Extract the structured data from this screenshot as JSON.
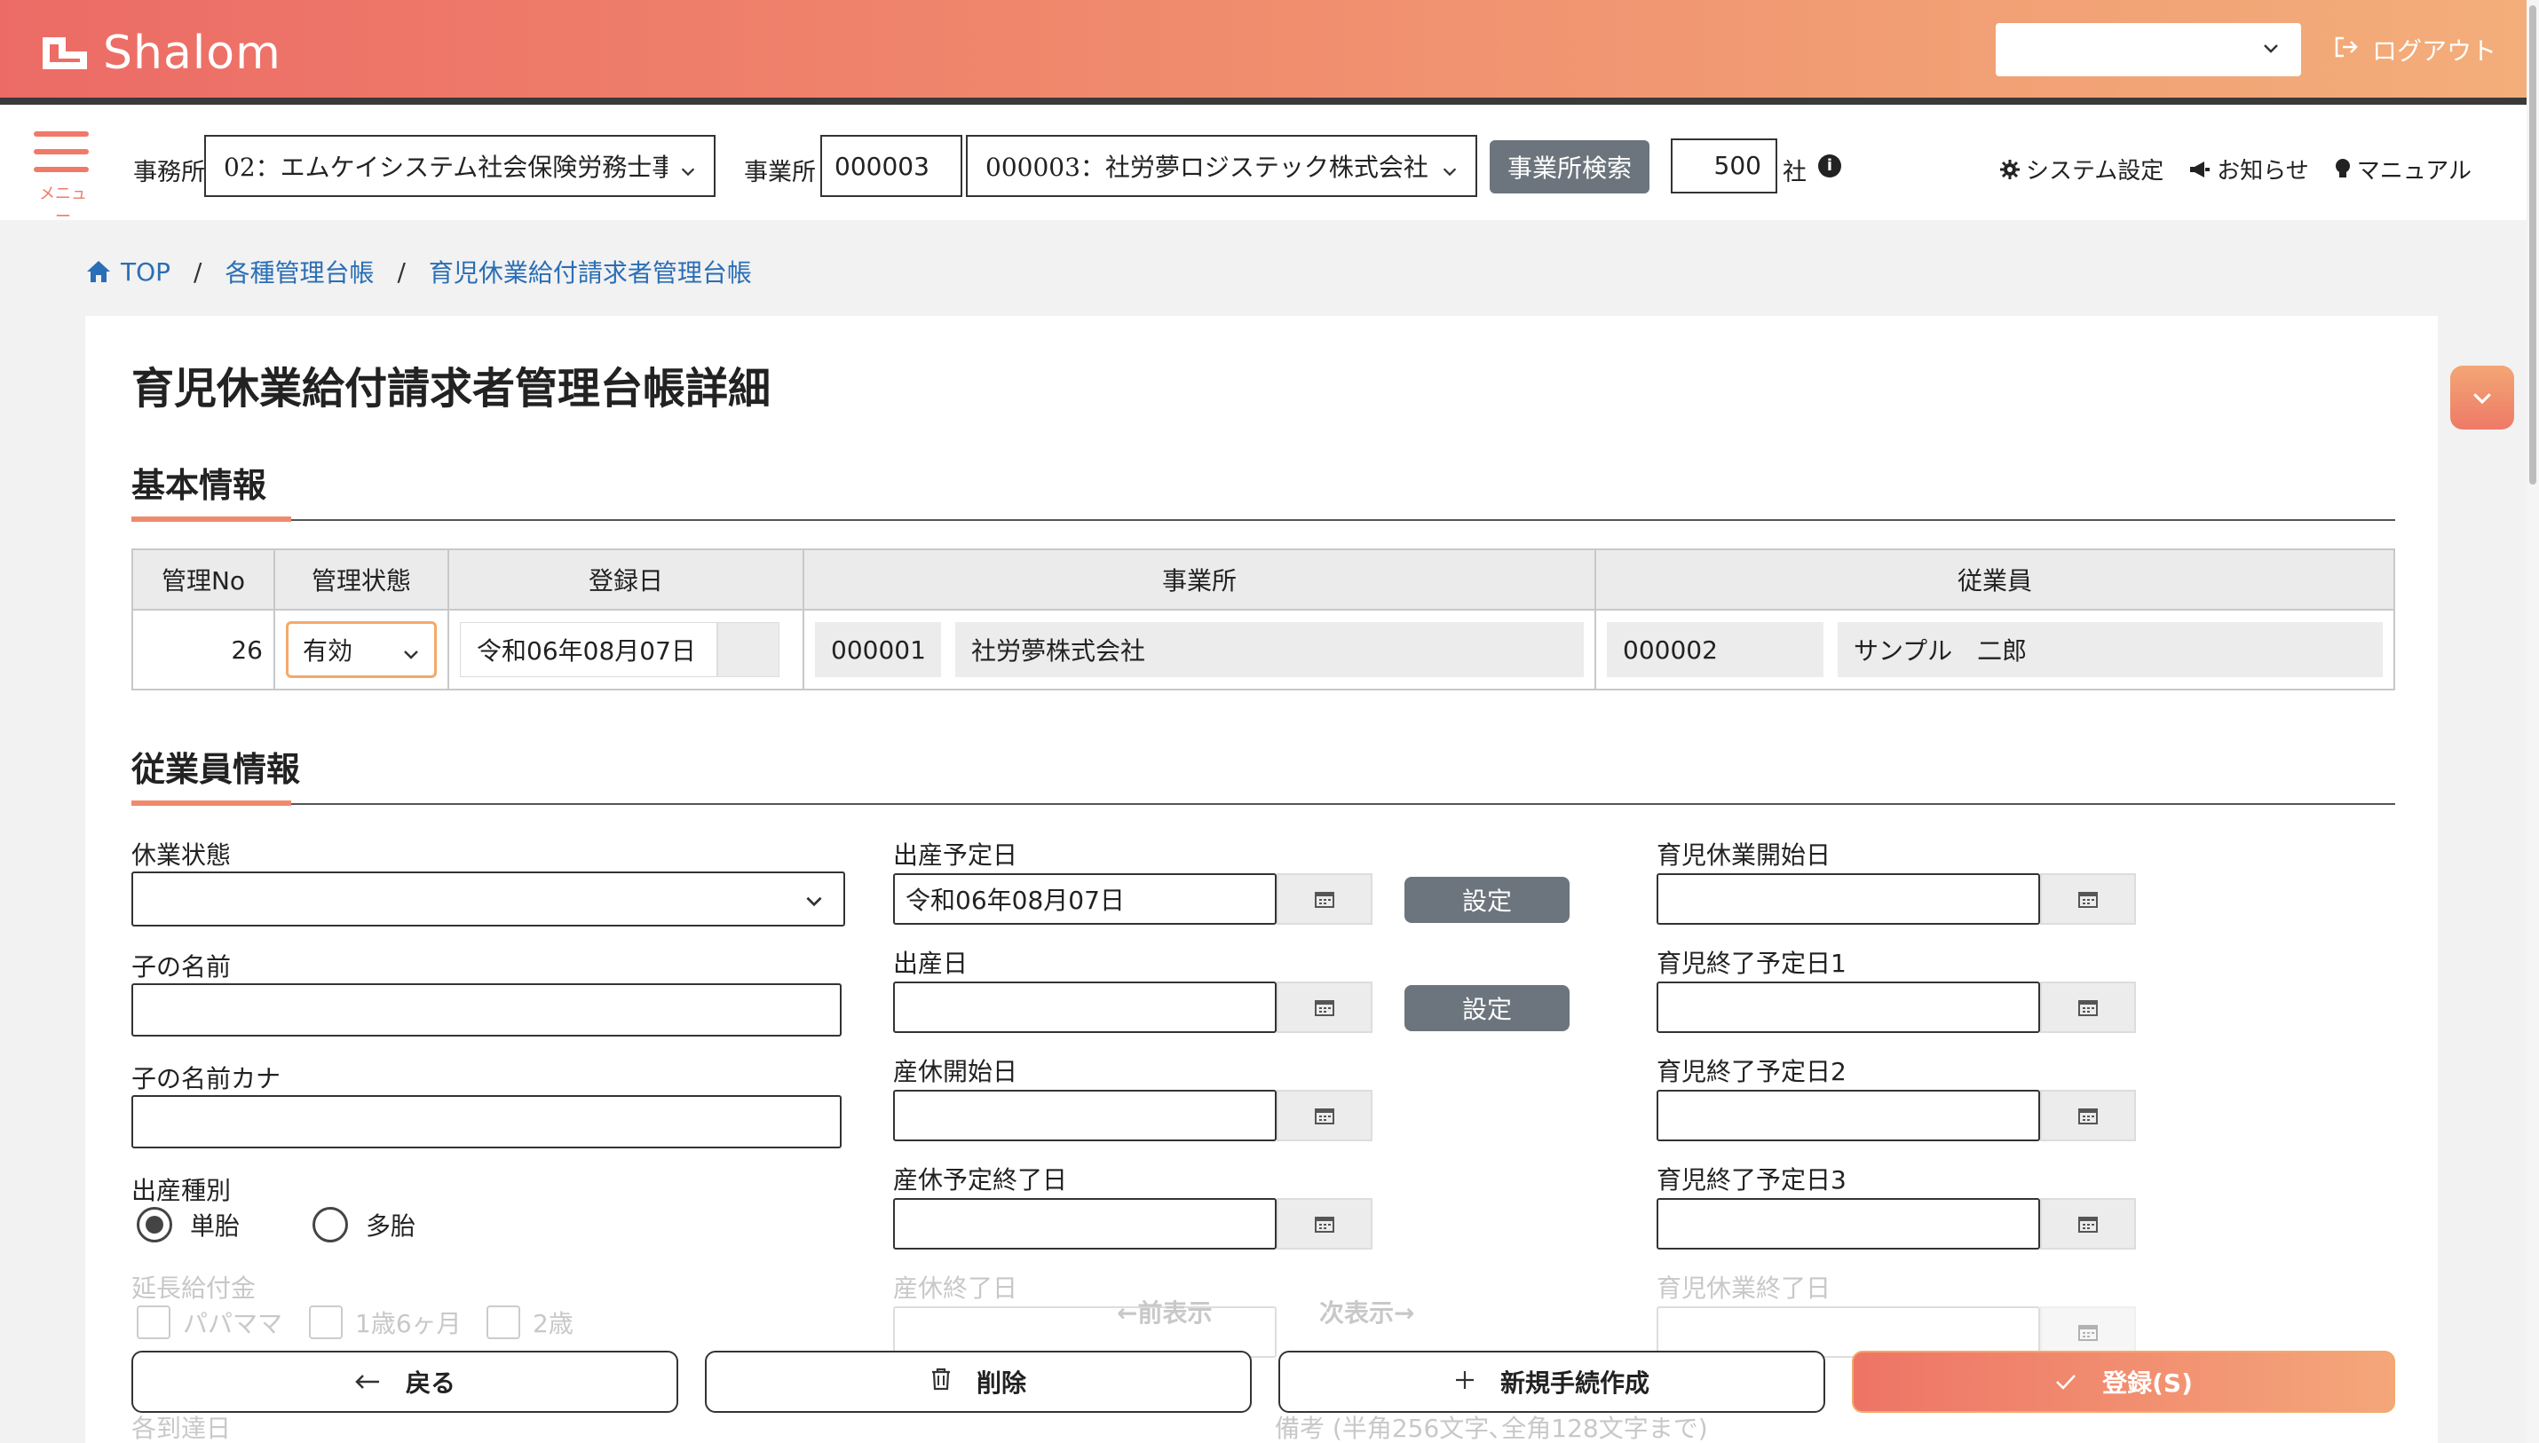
{
  "app": {
    "name": "Shalom"
  },
  "header": {
    "top_select_value": "",
    "logout_label": "ログアウト"
  },
  "nav": {
    "menu_label": "メニュー",
    "office_label": "事務所",
    "office_value": "02：エムケイシステム社会保険労務士事",
    "business_label": "事業所",
    "business_code": "000003",
    "business_value": "000003：社労夢ロジステック株式会社",
    "search_button": "事業所検索",
    "count_value": "500",
    "count_unit": "社",
    "info_icon": "i",
    "links": {
      "system": "システム設定",
      "news": "お知らせ",
      "manual": "マニュアル"
    }
  },
  "breadcrumb": {
    "top": "TOP",
    "sep": "/",
    "level1": "各種管理台帳",
    "level2": "育児休業給付請求者管理台帳"
  },
  "page": {
    "title": "育児休業給付請求者管理台帳詳細"
  },
  "basic": {
    "title": "基本情報",
    "headers": {
      "no": "管理No",
      "status": "管理状態",
      "reg_date": "登録日",
      "office": "事業所",
      "employee": "従業員"
    },
    "row": {
      "no": "26",
      "status": "有効",
      "reg_date": "令和06年08月07日",
      "office_code": "000001",
      "office_name": "社労夢株式会社",
      "employee_code": "000002",
      "employee_name": "サンプル　二郎"
    }
  },
  "employee": {
    "title": "従業員情報",
    "leave_status_label": "休業状態",
    "leave_status_value": "",
    "child_name_label": "子の名前",
    "child_name_value": "",
    "child_kana_label": "子の名前カナ",
    "child_kana_value": "",
    "birth_type_label": "出産種別",
    "birth_single": "単胎",
    "birth_multiple": "多胎",
    "birth_selected": "単胎",
    "extension_label": "延長給付金",
    "ext_papa": "パパママ",
    "ext_18m": "1歳6ヶ月",
    "ext_2y": "2歳",
    "arrival_label": "各到達日",
    "due_date_label": "出産予定日",
    "due_date_value": "令和06年08月07日",
    "birth_date_label": "出産日",
    "birth_date_value": "",
    "mat_start_label": "産休開始日",
    "mat_start_value": "",
    "mat_plan_end_label": "産休予定終了日",
    "mat_plan_end_value": "",
    "mat_end_label": "産休終了日",
    "set_button": "設定",
    "cc_start_label": "育児休業開始日",
    "cc_end1_label": "育児終了予定日1",
    "cc_end2_label": "育児終了予定日2",
    "cc_end3_label": "育児終了予定日3",
    "cc_end_label": "育児休業終了日",
    "remarks_label": "備考 (半角256文字､全角128文字まで)",
    "prev": "←前表示",
    "next": "次表示→"
  },
  "actions": {
    "back": "戻る",
    "delete": "削除",
    "new": "新規手続作成",
    "save": "登録(S)"
  },
  "colors": {
    "brand_start": "#ec6b66",
    "brand_end": "#f3ae7a",
    "link": "#2a6eb5",
    "gray_button": "#6c757d"
  }
}
